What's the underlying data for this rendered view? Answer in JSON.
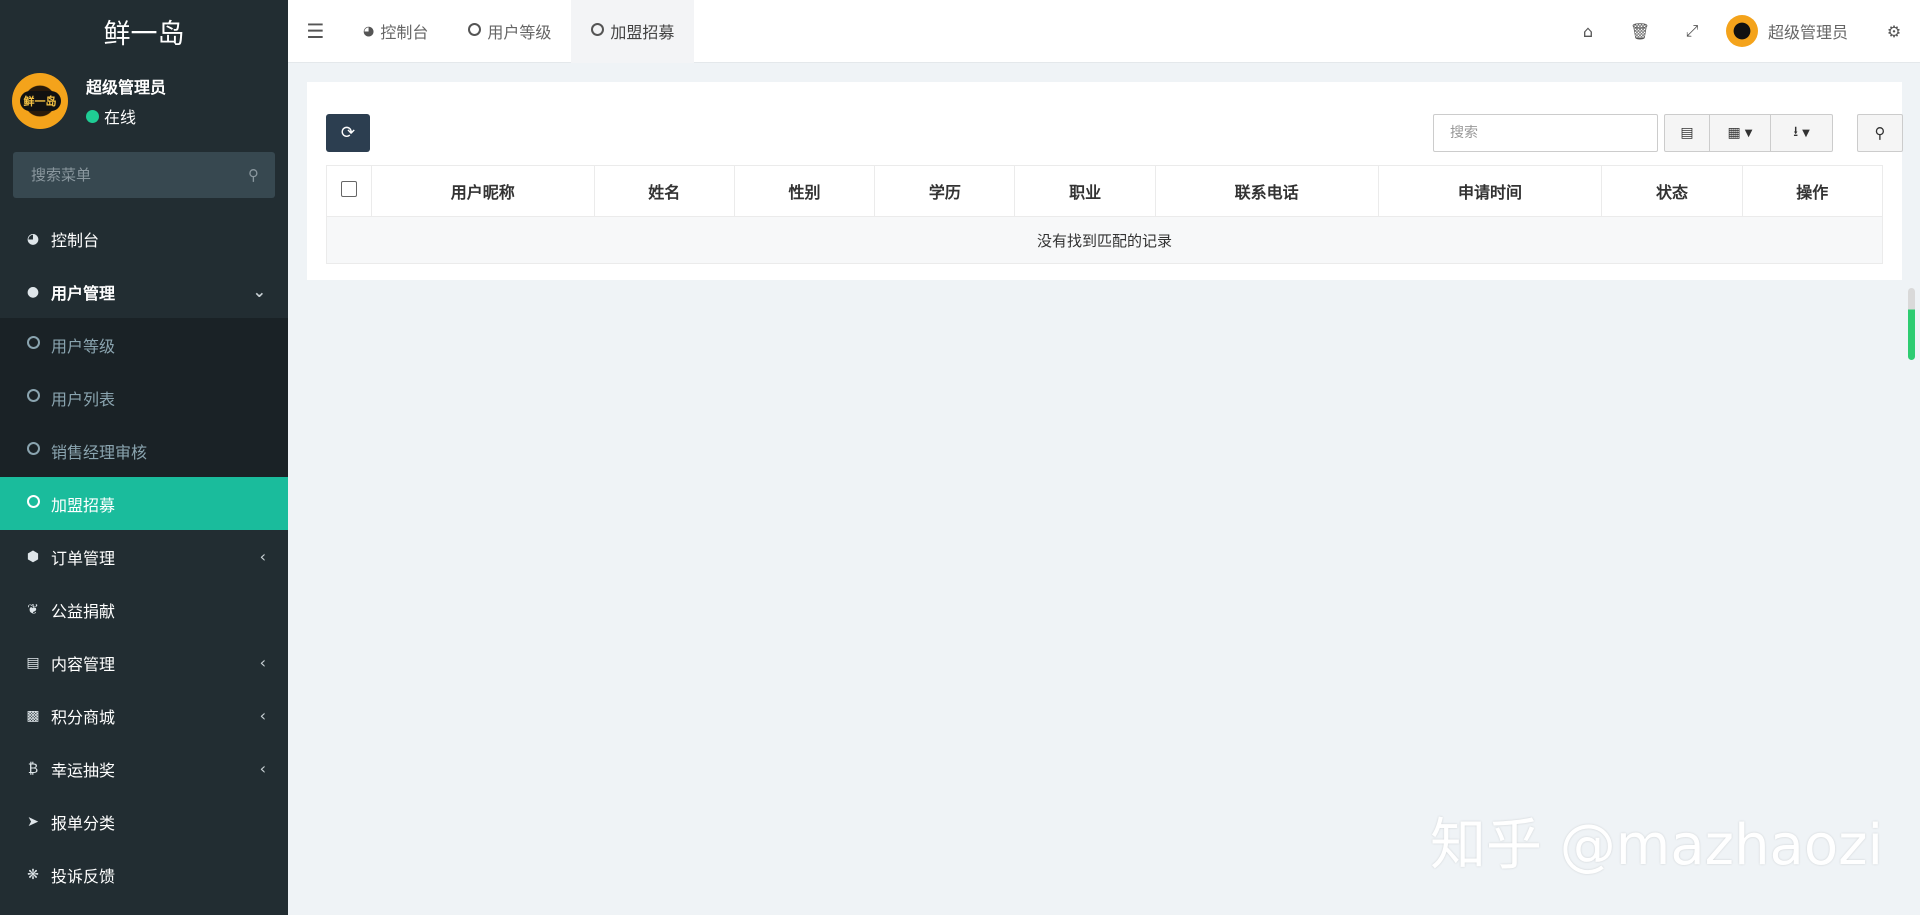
{
  "app": {
    "brand": "鲜一岛"
  },
  "user": {
    "name": "超级管理员",
    "status": "在线",
    "avatar_text": "鲜一岛"
  },
  "menu_search": {
    "placeholder": "搜索菜单"
  },
  "sidebar": {
    "items": [
      {
        "label": "控制台",
        "icon": "dashboard-icon"
      },
      {
        "label": "用户管理",
        "icon": "user-icon",
        "expanded": true
      },
      {
        "label": "用户等级",
        "icon": "circle-icon",
        "sub": true
      },
      {
        "label": "用户列表",
        "icon": "circle-icon",
        "sub": true
      },
      {
        "label": "销售经理审核",
        "icon": "circle-icon",
        "sub": true
      },
      {
        "label": "加盟招募",
        "icon": "circle-icon",
        "active": true
      },
      {
        "label": "订单管理",
        "icon": "cube-icon",
        "has_children": true
      },
      {
        "label": "公益捐献",
        "icon": "leaf-icon"
      },
      {
        "label": "内容管理",
        "icon": "file-icon",
        "has_children": true
      },
      {
        "label": "积分商城",
        "icon": "gift-icon",
        "has_children": true
      },
      {
        "label": "幸运抽奖",
        "icon": "bitcoin-icon",
        "has_children": true
      },
      {
        "label": "报单分类",
        "icon": "send-icon"
      },
      {
        "label": "投诉反馈",
        "icon": "gear-icon"
      }
    ]
  },
  "tabs": [
    {
      "label": "控制台",
      "icon": "dashboard-icon"
    },
    {
      "label": "用户等级",
      "icon": "circle-icon"
    },
    {
      "label": "加盟招募",
      "icon": "circle-icon",
      "active": true
    }
  ],
  "topbar": {
    "user_name": "超级管理员"
  },
  "table": {
    "search_placeholder": "搜索",
    "columns": [
      "用户昵称",
      "姓名",
      "性别",
      "学历",
      "职业",
      "联系电话",
      "申请时间",
      "状态",
      "操作"
    ],
    "empty_text": "没有找到匹配的记录"
  },
  "watermark": "知乎 @mazhaozi",
  "colors": {
    "sidebar_bg": "#222d32",
    "active": "#1abc9c",
    "online": "#1fcc94",
    "refresh_btn": "#2c3e50"
  }
}
